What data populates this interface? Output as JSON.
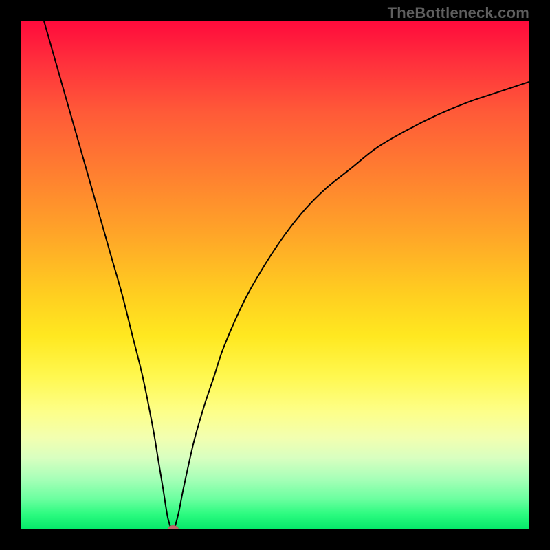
{
  "watermark": "TheBottleneck.com",
  "chart_data": {
    "type": "line",
    "title": "",
    "xlabel": "",
    "ylabel": "",
    "xlim": [
      0,
      100
    ],
    "ylim": [
      0,
      100
    ],
    "grid": false,
    "legend": false,
    "background_gradient": {
      "stops": [
        {
          "pct": 0,
          "color": "#ff0a3c"
        },
        {
          "pct": 30,
          "color": "#ff7f30"
        },
        {
          "pct": 60,
          "color": "#ffe820"
        },
        {
          "pct": 85,
          "color": "#d8ffc0"
        },
        {
          "pct": 100,
          "color": "#04e868"
        }
      ]
    },
    "series": [
      {
        "name": "bottleneck-curve",
        "color": "#000000",
        "x": [
          4,
          6,
          8,
          10,
          12,
          14,
          16,
          18,
          20,
          22,
          24,
          26,
          27,
          28,
          29,
          30,
          31,
          32,
          34,
          36,
          38,
          40,
          44,
          48,
          52,
          56,
          60,
          65,
          70,
          76,
          82,
          88,
          94,
          100
        ],
        "y": [
          102,
          95,
          88,
          81,
          74,
          67,
          60,
          53,
          46,
          38,
          30,
          20,
          14,
          8,
          2,
          0,
          3,
          8,
          17,
          24,
          30,
          36,
          45,
          52,
          58,
          63,
          67,
          71,
          75,
          78.5,
          81.5,
          84,
          86,
          88
        ]
      }
    ],
    "marker": {
      "x": 30,
      "y": 0,
      "color": "#c06a6a"
    },
    "notes": "V-shaped curve on vertical rainbow gradient; minimum sits on the green band near x≈30. Values are estimates read from the image in 0–100 normalized coordinates."
  }
}
